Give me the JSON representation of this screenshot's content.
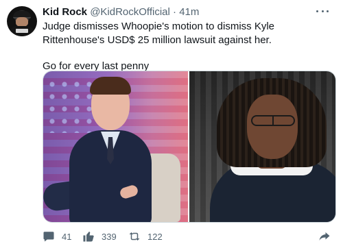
{
  "tweet": {
    "author": {
      "name": "Kid Rock",
      "handle": "@KidRockOfficial",
      "time": "41m",
      "separator": "·"
    },
    "text": [
      "Judge dismisses Whoopie's motion to dismiss Kyle Rittenhouse's USD$ 25 million lawsuit against her.",
      "Go for every last penny"
    ],
    "media": {
      "left_image": "man-in-suit-photo",
      "right_image": "woman-with-locs-photo"
    },
    "actions": {
      "reply": {
        "count": "41",
        "icon": "reply-icon"
      },
      "like": {
        "count": "339",
        "icon": "thumbs-up-icon"
      },
      "retweet": {
        "count": "122",
        "icon": "retweet-icon"
      },
      "share": {
        "icon": "share-icon"
      }
    },
    "more_icon": "more-options-icon"
  }
}
